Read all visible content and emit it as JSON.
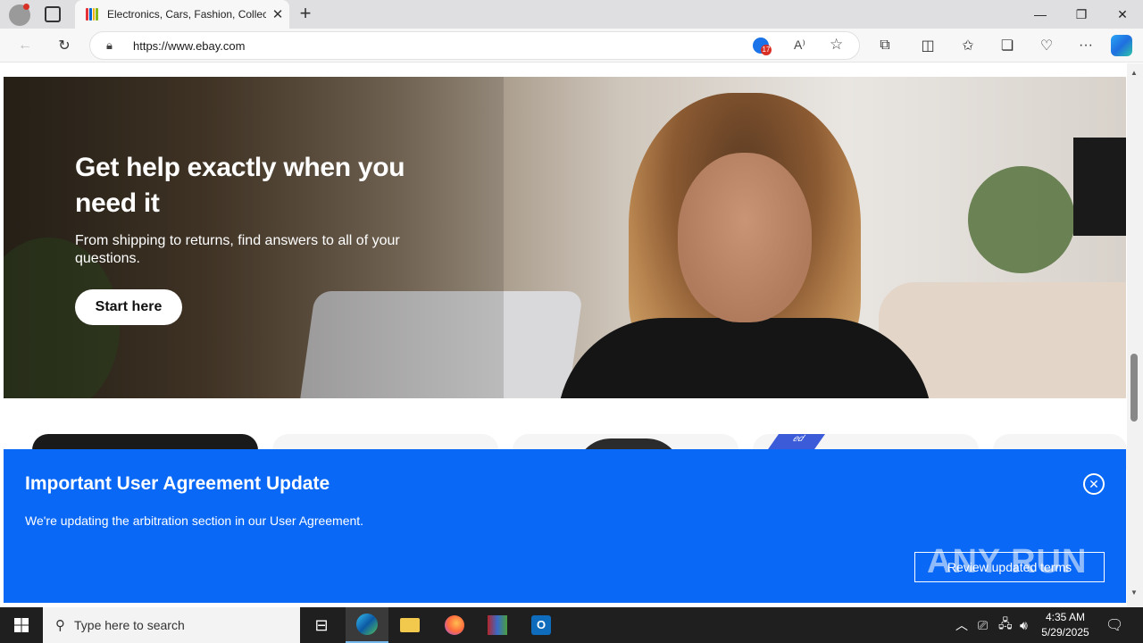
{
  "browser": {
    "tab_title": "Electronics, Cars, Fashion, Collectibles & More | eBay",
    "url": "https://www.ebay.com",
    "tracking_badge_count": "17"
  },
  "hero": {
    "title": "Get help exactly when you need it",
    "subtitle": "From shipping to returns, find answers to all of your questions.",
    "button_label": "Start here"
  },
  "card_badge_fragment": "ed",
  "notice": {
    "title": "Important User Agreement Update",
    "text": "We're updating the arbitration section in our User Agreement.",
    "button_label": "Review updated terms"
  },
  "watermark": "ANY RUN",
  "taskbar": {
    "search_placeholder": "Type here to search",
    "time": "4:35 AM",
    "date": "5/29/2025"
  },
  "colors": {
    "notice_bg": "#0968f6",
    "taskbar_bg": "#1f1f1f"
  }
}
